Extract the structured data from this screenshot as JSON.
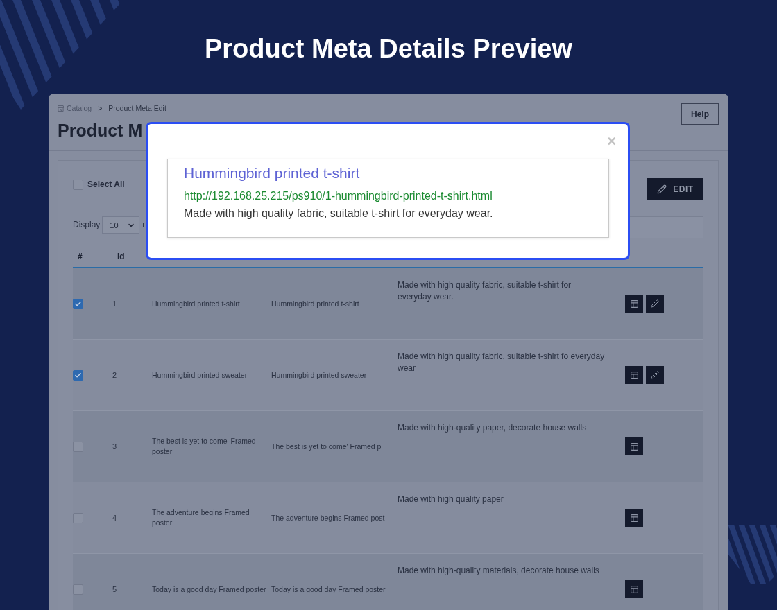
{
  "heading": "Product Meta Details Preview",
  "breadcrumb": {
    "items": [
      {
        "label": "Catalog"
      },
      {
        "label": "Product Meta Edit"
      }
    ],
    "separator": ">"
  },
  "page_title": "Product M",
  "help_button": "Help",
  "toolbar": {
    "select_all": {
      "label": "Select All",
      "checked": false
    },
    "edit_button": "EDIT"
  },
  "display": {
    "label": "Display",
    "value": "10",
    "trailing_text": "r"
  },
  "table": {
    "columns": [
      "#",
      "Id"
    ],
    "rows": [
      {
        "checked": true,
        "id": "1",
        "name": "Hummingbird printed t-shirt",
        "column_4": "Hummingbird printed t-shirt",
        "description": "Made with high quality fabric, suitable t-shirt for everyday wear.",
        "actions": [
          {
            "kind": "view"
          },
          {
            "kind": "edit"
          }
        ]
      },
      {
        "checked": true,
        "id": "2",
        "name": "Hummingbird printed sweater",
        "column_4": "Hummingbird printed sweater",
        "description": "Made with high quality fabric, suitable t-shirt fo everyday wear",
        "actions": [
          {
            "kind": "view"
          },
          {
            "kind": "edit"
          }
        ]
      },
      {
        "checked": false,
        "id": "3",
        "name": "The best is yet to come' Framed poster",
        "column_4": "The best is yet to come' Framed p",
        "description": "Made with high-quality paper, decorate house walls",
        "actions": [
          {
            "kind": "view"
          }
        ]
      },
      {
        "checked": false,
        "id": "4",
        "name": "The adventure begins Framed poster",
        "column_4": "The adventure begins Framed post",
        "description": "Made with high quality paper",
        "actions": [
          {
            "kind": "view"
          }
        ]
      },
      {
        "checked": false,
        "id": "5",
        "name": "Today is a good day Framed poster",
        "column_4": "Today is a good day Framed poster",
        "description": "Made with high-quality materials, decorate house walls",
        "actions": [
          {
            "kind": "view"
          }
        ]
      }
    ]
  },
  "preview_modal": {
    "close": "×",
    "title": "Hummingbird printed t-shirt",
    "url": "http://192.168.25.215/ps910/1-hummingbird-printed-t-shirt.html",
    "description": "Made with high quality fabric, suitable t-shirt for everyday wear."
  }
}
